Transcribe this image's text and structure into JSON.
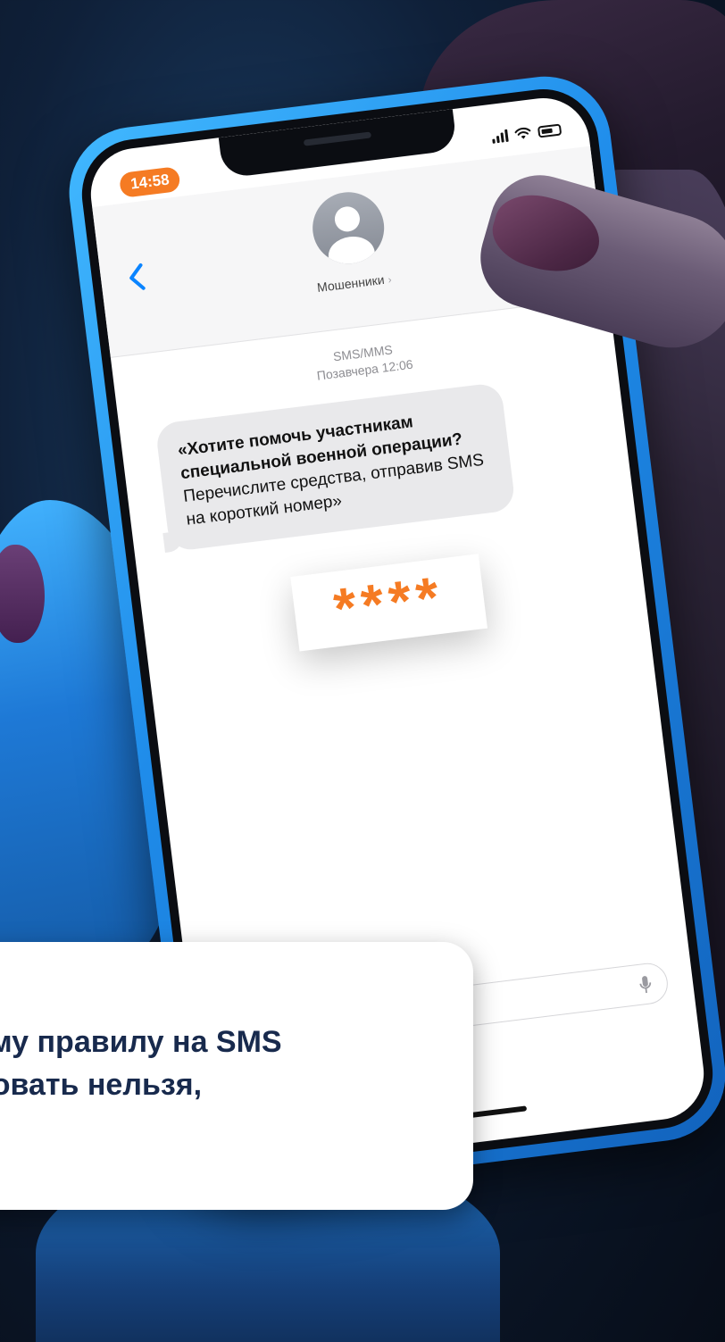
{
  "status_bar": {
    "time": "14:58"
  },
  "conversation": {
    "contact_name": "Мошенники",
    "contact_chevron": "›",
    "message_type": "SMS/MMS",
    "timestamp": "Позавчера 12:06"
  },
  "message": {
    "bold_text": "«Хотите помочь участникам специальной военной операции?",
    "normal_text": "Перечислите средства, отправив SMS на короткий номер»",
    "code": "****"
  },
  "caption": {
    "line1": "ему правилу на SMS",
    "line2": "ровать нельзя,"
  },
  "colors": {
    "accent_orange": "#f57b23",
    "phone_blue": "#1f8cea",
    "caption_text": "#182a4d",
    "ios_blue": "#0a84ff"
  }
}
